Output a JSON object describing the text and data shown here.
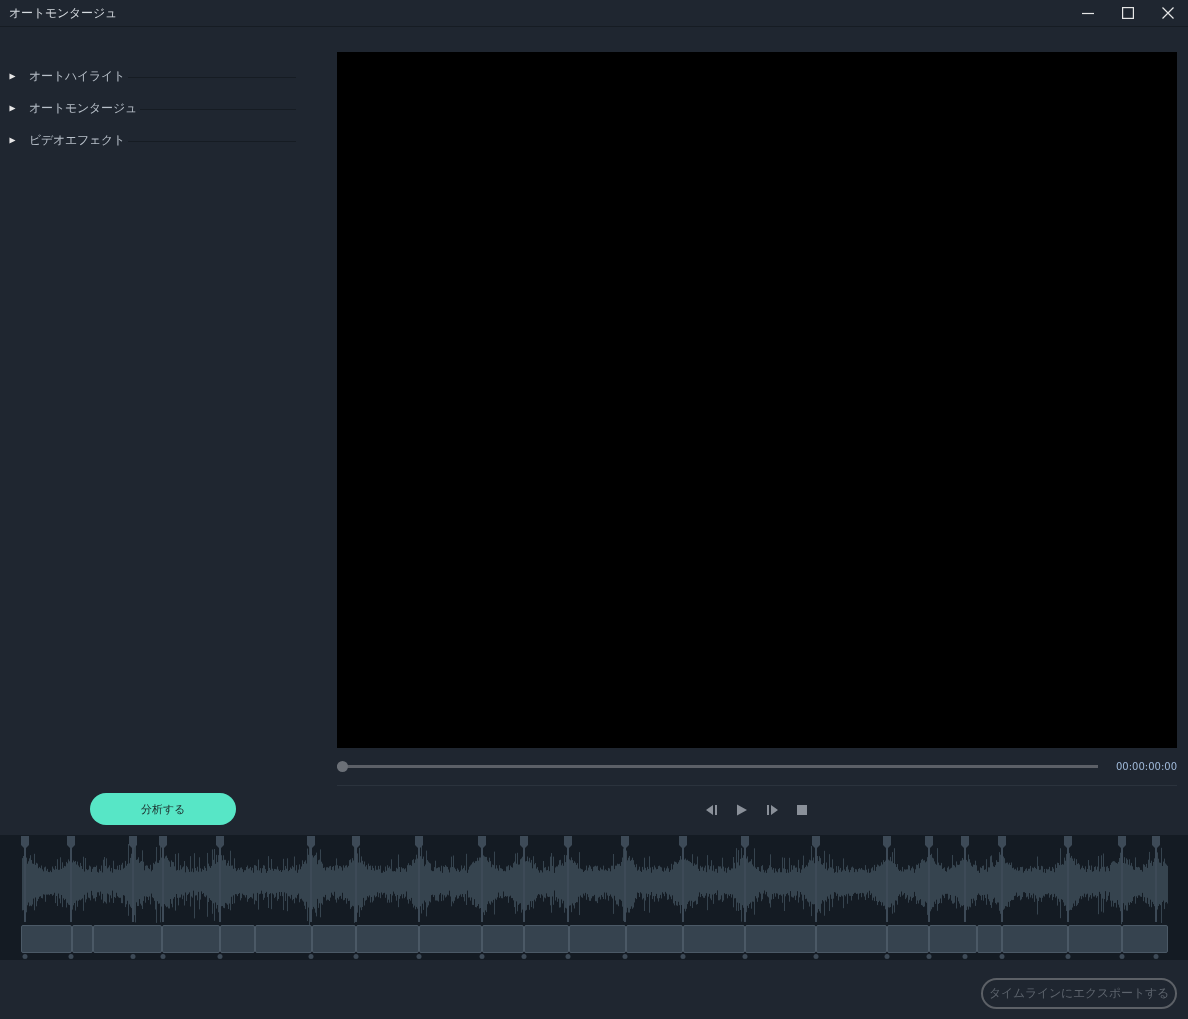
{
  "window": {
    "title": "オートモンタージュ"
  },
  "sidebar": {
    "items": [
      {
        "label": "オートハイライト",
        "expanded": false
      },
      {
        "label": "オートモンタージュ",
        "expanded": false
      },
      {
        "label": "ビデオエフェクト",
        "expanded": false
      }
    ]
  },
  "analyze_button": {
    "label": "分析する"
  },
  "player": {
    "seek": {
      "level": 0
    },
    "timecode": "00:00:00:00"
  },
  "export_button": {
    "label": "タイムラインにエクスポートする",
    "disabled": true
  }
}
